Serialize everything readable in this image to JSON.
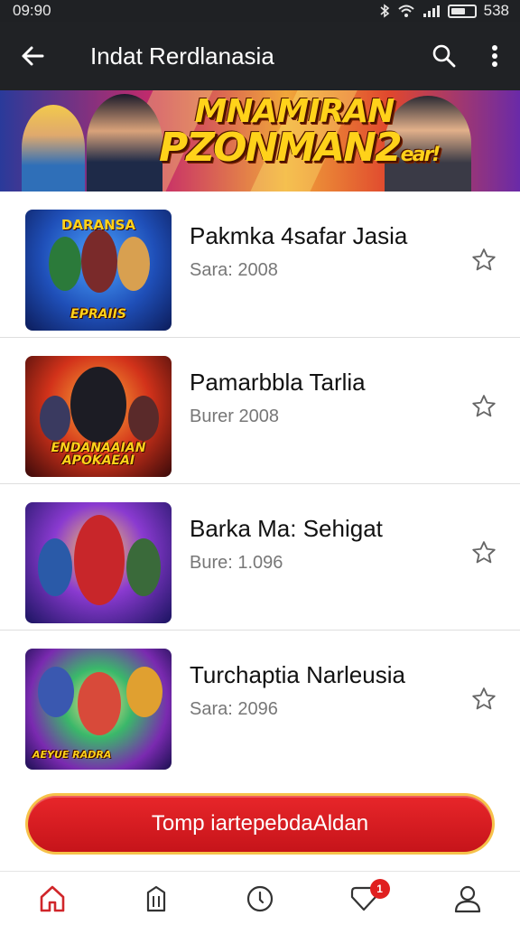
{
  "status_bar": {
    "time": "09:90",
    "battery_text": "538",
    "battery_level": 0.7,
    "icons": [
      "bluetooth-icon",
      "wifi-icon",
      "signal-icon",
      "battery-icon"
    ]
  },
  "app_bar": {
    "title": "Indat Rerdlanasia",
    "back_icon": "arrow-left-icon",
    "search_icon": "search-icon",
    "menu_icon": "more-vertical-icon"
  },
  "banner": {
    "line1": "MNAMIRAN",
    "line2": "PZONMAN2",
    "tag": "ear!"
  },
  "games": [
    {
      "title": "Pakmka 4safar Jasia",
      "subtitle": "Sara: 2008",
      "thumb_top": "DARANSA",
      "thumb_caption": "EPRAIIS",
      "favorite": false
    },
    {
      "title": "Pamarbbla Tarlia",
      "subtitle": "Burer 2008",
      "thumb_top": "",
      "thumb_caption": "ENDANAAIAN APOKAEAI",
      "favorite": false
    },
    {
      "title": "Barka Ma: Sehigat",
      "subtitle": "Bure: 1.096",
      "thumb_top": "",
      "thumb_caption": "",
      "favorite": false
    },
    {
      "title": "Turchaptia Narleusia",
      "subtitle": "Sara: 2096",
      "thumb_top": "",
      "thumb_caption": "AEYUE RADRA",
      "favorite": false
    }
  ],
  "cta": {
    "label": "Tomp iartepebdaAldan"
  },
  "bottom_nav": {
    "items": [
      "home-icon",
      "library-icon",
      "compass-icon",
      "favorites-icon",
      "profile-icon"
    ],
    "badge_count": "1",
    "accent_color": "#d0262a"
  },
  "colors": {
    "app_bar": "#202225",
    "cta_red": "#d41c20",
    "cta_border": "#f6c24a"
  }
}
